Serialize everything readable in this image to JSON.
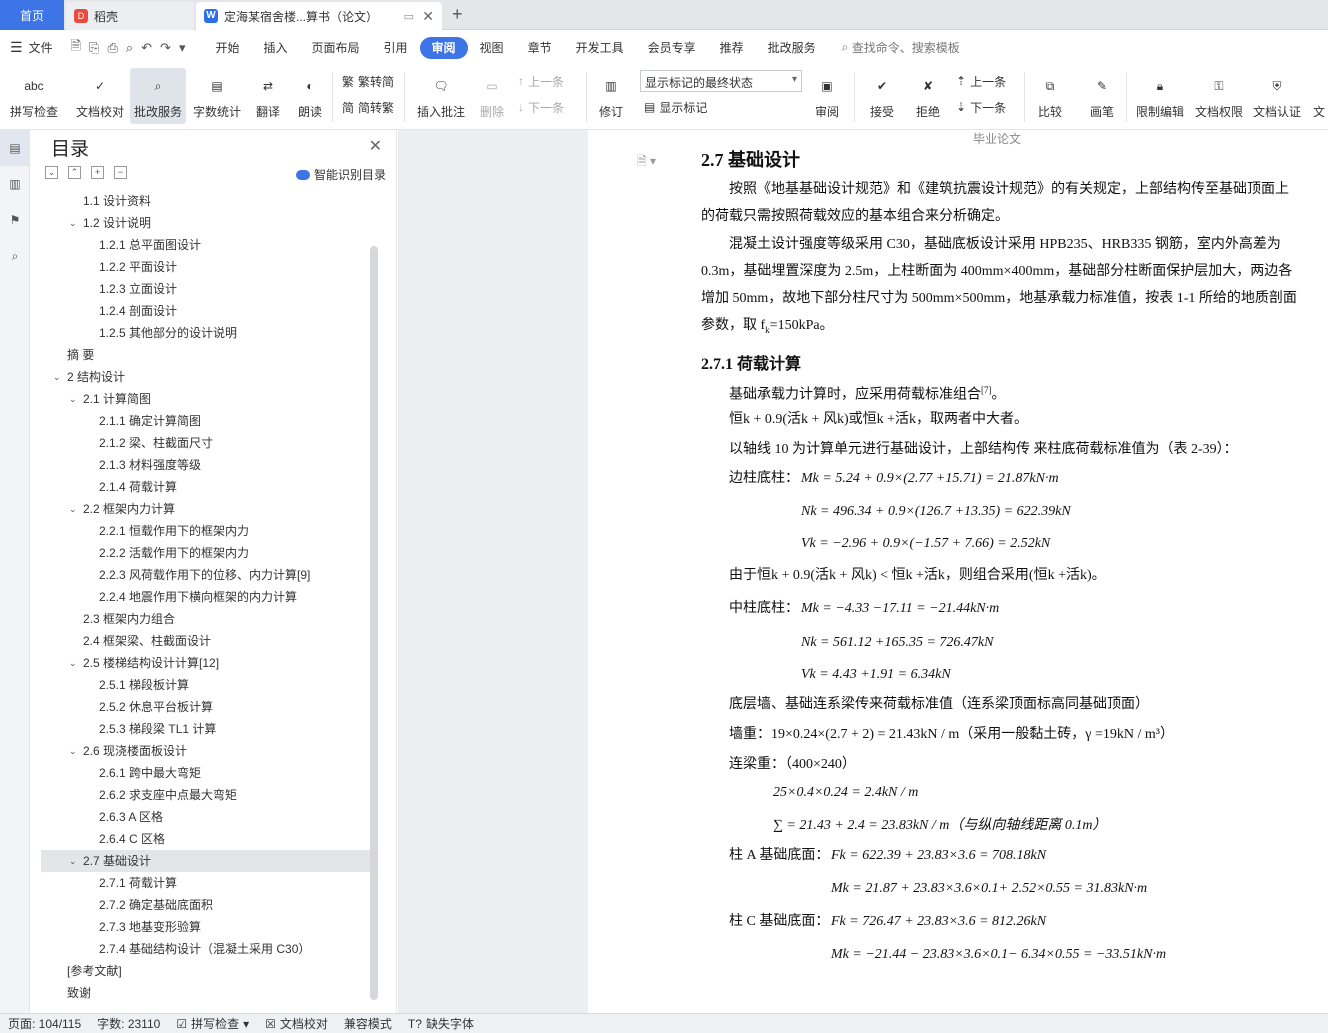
{
  "tabs": {
    "home": "首页",
    "daoke": "稻壳",
    "doc": "定海某宿舍楼...算书（论文）"
  },
  "menu": {
    "file": "文件",
    "tabs": [
      "开始",
      "插入",
      "页面布局",
      "引用",
      "审阅",
      "视图",
      "章节",
      "开发工具",
      "会员专享",
      "推荐",
      "批改服务"
    ],
    "search": "查找命令、搜索模板"
  },
  "ribbon": {
    "spell": "拼写检查",
    "proof": "文档校对",
    "correct": "批改服务",
    "wordcount": "字数统计",
    "translate": "翻译",
    "read": "朗读",
    "t2s": "繁转简",
    "s2t": "简转繁",
    "insert_comment": "插入批注",
    "delete": "删除",
    "prev_comment": "上一条",
    "next_comment": "下一条",
    "revise": "修订",
    "display_mode": "显示标记的最终状态",
    "show_marks": "显示标记",
    "review": "审阅",
    "accept": "接受",
    "reject": "拒绝",
    "prev": "上一条",
    "next": "下一条",
    "compare": "比较",
    "ink": "画笔",
    "restrict": "限制编辑",
    "perm": "文档权限",
    "cert": "文档认证",
    "more": "文"
  },
  "toc": {
    "title": "目录",
    "smart": "智能识别目录",
    "items": [
      {
        "t": "1.1  设计资料",
        "l": 1
      },
      {
        "t": "1.2 设计说明",
        "l": 1,
        "c": 1
      },
      {
        "t": "1.2.1 总平面图设计",
        "l": 2
      },
      {
        "t": "1.2.2  平面设计",
        "l": 2
      },
      {
        "t": "1.2.3  立面设计",
        "l": 2
      },
      {
        "t": "1.2.4  剖面设计",
        "l": 2
      },
      {
        "t": "1.2.5  其他部分的设计说明",
        "l": 2
      },
      {
        "t": "摘   要",
        "l": 0
      },
      {
        "t": "2  结构设计",
        "l": 0,
        "c": 1
      },
      {
        "t": "2.1 计算简图",
        "l": 1,
        "c": 1
      },
      {
        "t": "2.1.1 确定计算简图",
        "l": 2
      },
      {
        "t": "2.1.2  梁、柱截面尺寸",
        "l": 2
      },
      {
        "t": "2.1.3 材料强度等级",
        "l": 2
      },
      {
        "t": "2.1.4 荷载计算",
        "l": 2
      },
      {
        "t": "2.2 框架内力计算",
        "l": 1,
        "c": 1
      },
      {
        "t": "2.2.1 恒载作用下的框架内力",
        "l": 2
      },
      {
        "t": "2.2.2 活载作用下的框架内力",
        "l": 2
      },
      {
        "t": "2.2.3 风荷载作用下的位移、内力计算[9]",
        "l": 2
      },
      {
        "t": "2.2.4 地震作用下横向框架的内力计算",
        "l": 2
      },
      {
        "t": "2.3 框架内力组合",
        "l": 1
      },
      {
        "t": "2.4 框架梁、柱截面设计",
        "l": 1
      },
      {
        "t": "2.5 楼梯结构设计计算[12]",
        "l": 1,
        "c": 1
      },
      {
        "t": "2.5.1 梯段板计算",
        "l": 2
      },
      {
        "t": "2.5.2 休息平台板计算",
        "l": 2
      },
      {
        "t": "2.5.3 梯段梁 TL1 计算",
        "l": 2
      },
      {
        "t": "2.6 现浇楼面板设计",
        "l": 1,
        "c": 1
      },
      {
        "t": "2.6.1 跨中最大弯矩",
        "l": 2
      },
      {
        "t": "2.6.2 求支座中点最大弯矩",
        "l": 2
      },
      {
        "t": "2.6.3 A 区格",
        "l": 2
      },
      {
        "t": "2.6.4 C 区格",
        "l": 2
      },
      {
        "t": "2.7 基础设计",
        "l": 1,
        "c": 1,
        "sel": 1
      },
      {
        "t": "2.7.1 荷载计算",
        "l": 2
      },
      {
        "t": "2.7.2 确定基础底面积",
        "l": 2
      },
      {
        "t": "2.7.3 地基变形验算",
        "l": 2
      },
      {
        "t": "2.7.4 基础结构设计（混凝土采用 C30）",
        "l": 2
      },
      {
        "t": "[参考文献]",
        "l": 0
      },
      {
        "t": "致谢",
        "l": 0
      }
    ]
  },
  "doc": {
    "header": "毕业论文",
    "h27": "2.7 基础设计",
    "p1": "按照《地基基础设计规范》和《建筑抗震设计规范》的有关规定，上部结构传至基础顶面上的荷载只需按照荷载效应的基本组合来分析确定。",
    "p2": "混凝土设计强度等级采用 C30，基础底板设计采用 HPB235、HRB335 钢筋，室内外高差为 0.3m，基础埋置深度为 2.5m，上柱断面为 400mm×400mm，基础部分柱断面保护层加大，两边各增加 50mm，故地下部分柱尺寸为 500mm×500mm，地基承载力标准值，按表 1-1 所给的地质剖面参数，取 f",
    "p2end": "=150kPa。",
    "h271": "2.7.1 荷载计算",
    "l1": "基础承载力计算时，应采用荷载标准组合",
    "l1ref": "[7]",
    "l1end": "。",
    "l2": "恒k + 0.9(活k + 风k)或恒k +活k，取两者中大者。",
    "l3": "以轴线 10 为计算单元进行基础设计，上部结构传  来柱底荷载标准值为（表 2-39）：",
    "edge_label": "边柱底柱：",
    "e1": "Mk = 5.24 + 0.9×(2.77 +15.71) = 21.87kN·m",
    "e2": "Nk = 496.34 + 0.9×(126.7 +13.35) = 622.39kN",
    "e3": "Vk = −2.96 + 0.9×(−1.57 + 7.66) = 2.52kN",
    "l4": "由于恒k + 0.9(活k + 风k) < 恒k +活k，则组合采用(恒k +活k)。",
    "mid_label": "中柱底柱：",
    "m1": "Mk = −4.33 −17.11 = −21.44kN·m",
    "m2": "Nk = 561.12 +165.35 = 726.47kN",
    "m3": "Vk = 4.43 +1.91 = 6.34kN",
    "l5": "底层墙、基础连系梁传来荷载标准值（连系梁顶面标高同基础顶面）",
    "wall": "墙重：19×0.24×(2.7 + 2) = 21.43kN / m（采用一般黏土砖，γ =19kN / m³）",
    "beam_label": "连梁重：（400×240）",
    "b1": "25×0.4×0.24 = 2.4kN / m",
    "b2": "∑ = 21.43 + 2.4 = 23.83kN / m（与纵向轴线距离 0.1m）",
    "colA_label": "柱 A 基础底面：",
    "a1": "Fk = 622.39 + 23.83×3.6 = 708.18kN",
    "a2": "Mk = 21.87 + 23.83×3.6×0.1+ 2.52×0.55 = 31.83kN·m",
    "colC_label": "柱 C 基础底面：",
    "c1": "Fk = 726.47 + 23.83×3.6 = 812.26kN",
    "c2": "Mk = −21.44 − 23.83×3.6×0.1− 6.34×0.55 = −33.51kN·m"
  },
  "status": {
    "page": "页面: 104/115",
    "words": "字数: 23110",
    "spell": "拼写检查",
    "proof": "文档校对",
    "compat": "兼容模式",
    "font": "缺失字体"
  }
}
